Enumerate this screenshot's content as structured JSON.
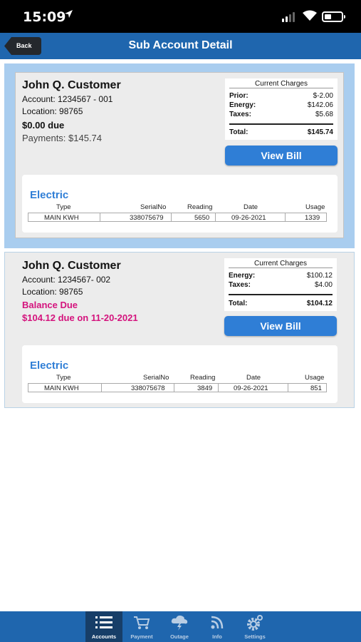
{
  "status": {
    "time": "15:09",
    "location_icon": "location-arrow-icon"
  },
  "header": {
    "back_label": "Back",
    "title": "Sub Account Detail"
  },
  "charges_title": "Current Charges",
  "view_bill_label": "View Bill",
  "electric_label": "Electric",
  "columns": [
    "Type",
    "SerialNo",
    "Reading",
    "Date",
    "Usage"
  ],
  "accounts": [
    {
      "name": "John Q. Customer",
      "account": "Account:  1234567 - 001",
      "location": "Location:  98765",
      "due": "$0.00 due",
      "payments": "Payments: $145.74",
      "charges": [
        {
          "label": "Prior:",
          "value": "$-2.00"
        },
        {
          "label": "Energy:",
          "value": "$142.06"
        },
        {
          "label": "Taxes:",
          "value": "$5.68"
        }
      ],
      "total_label": "Total:",
      "total": "$145.74",
      "meter": {
        "type": "MAIN KWH",
        "serial": "338075679",
        "reading": "5650",
        "date": "09-26-2021",
        "usage": "1339"
      }
    },
    {
      "name": "John Q. Customer",
      "account": "Account:  1234567- 002",
      "location": "Location:  98765",
      "balance_label": "Balance Due",
      "due": "$104.12 due on 11-20-2021",
      "charges": [
        {
          "label": "Energy:",
          "value": "$100.12"
        },
        {
          "label": "Taxes:",
          "value": "$4.00"
        }
      ],
      "total_label": "Total:",
      "total": "$104.12",
      "meter": {
        "type": "MAIN KWH",
        "serial": "338075678",
        "reading": "3849",
        "date": "09-26-2021",
        "usage": "851"
      }
    }
  ],
  "nav": [
    {
      "label": "Accounts",
      "icon": "list-icon",
      "active": true
    },
    {
      "label": "Payment",
      "icon": "cart-icon",
      "active": false
    },
    {
      "label": "Outage",
      "icon": "storm-cloud-icon",
      "active": false
    },
    {
      "label": "Info",
      "icon": "rss-icon",
      "active": false
    },
    {
      "label": "Settings",
      "icon": "gear-icon",
      "active": false
    }
  ],
  "colors": {
    "header": "#1f66ae",
    "accent": "#2f7ed6",
    "balance_due": "#d4137d",
    "selected_card": "#a9cdef"
  }
}
